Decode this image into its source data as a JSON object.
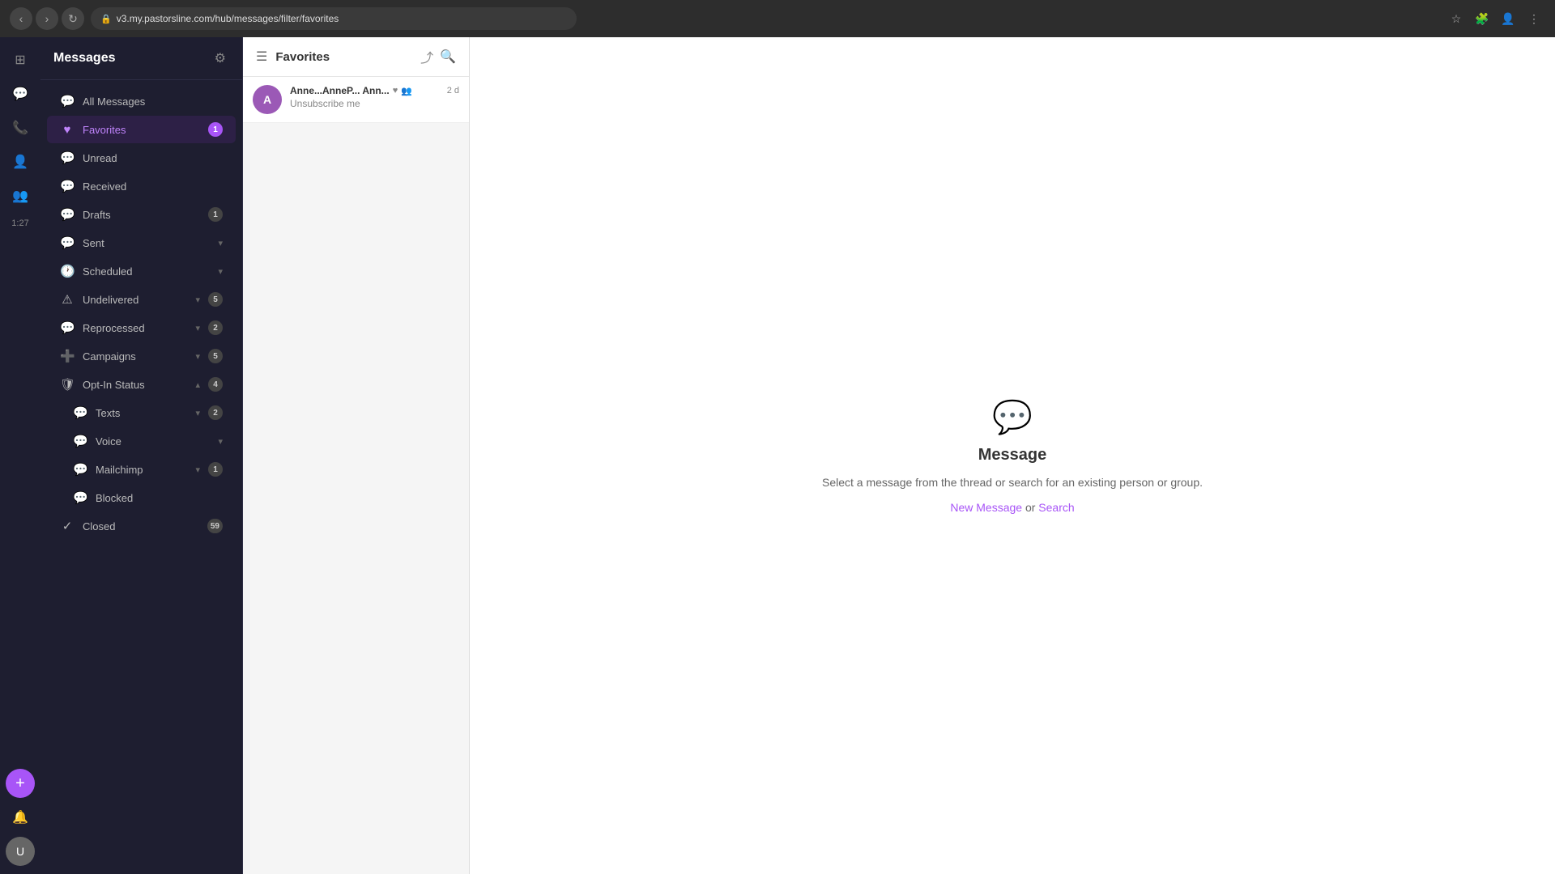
{
  "browser": {
    "url": "v3.my.pastorsline.com/hub/messages/filter/favorites",
    "lock_icon": "🔒"
  },
  "sidebar": {
    "title": "Messages",
    "nav_items": [
      {
        "id": "all-messages",
        "icon": "💬",
        "label": "All Messages",
        "badge": null,
        "active": false,
        "sub": false
      },
      {
        "id": "favorites",
        "icon": "♥",
        "label": "Favorites",
        "badge": "1",
        "active": true,
        "sub": false
      },
      {
        "id": "unread",
        "icon": "💬",
        "label": "Unread",
        "badge": null,
        "active": false,
        "sub": false
      },
      {
        "id": "received",
        "icon": "💬",
        "label": "Received",
        "badge": null,
        "active": false,
        "sub": false
      },
      {
        "id": "drafts",
        "icon": "💬",
        "label": "Drafts",
        "badge": "1",
        "active": false,
        "sub": false
      },
      {
        "id": "sent",
        "icon": "💬",
        "label": "Sent",
        "badge": null,
        "chevron": true,
        "active": false,
        "sub": false
      },
      {
        "id": "scheduled",
        "icon": "🕐",
        "label": "Scheduled",
        "badge": null,
        "chevron": true,
        "active": false,
        "sub": false
      },
      {
        "id": "undelivered",
        "icon": "⚠",
        "label": "Undelivered",
        "badge": "5",
        "chevron": true,
        "active": false,
        "sub": false
      },
      {
        "id": "reprocessed",
        "icon": "💬",
        "label": "Reprocessed",
        "badge": "2",
        "chevron": true,
        "active": false,
        "sub": false
      },
      {
        "id": "campaigns",
        "icon": "➕",
        "label": "Campaigns",
        "badge": "5",
        "chevron": true,
        "active": false,
        "sub": false
      },
      {
        "id": "opt-in-status",
        "icon": "🛡",
        "label": "Opt-In Status",
        "badge": "4",
        "chevron_up": true,
        "active": false,
        "sub": false
      },
      {
        "id": "texts",
        "icon": "💬",
        "label": "Texts",
        "badge": "2",
        "chevron": true,
        "active": false,
        "sub": true
      },
      {
        "id": "voice",
        "icon": "💬",
        "label": "Voice",
        "badge": null,
        "chevron": true,
        "active": false,
        "sub": true
      },
      {
        "id": "mailchimp",
        "icon": "💬",
        "label": "Mailchimp",
        "badge": "1",
        "chevron": true,
        "active": false,
        "sub": true
      },
      {
        "id": "blocked",
        "icon": "💬",
        "label": "Blocked",
        "badge": null,
        "active": false,
        "sub": true
      },
      {
        "id": "closed",
        "icon": "✓",
        "label": "Closed",
        "badge": "59",
        "active": false,
        "sub": false
      }
    ]
  },
  "favorites_panel": {
    "title": "Favorites",
    "conversation": {
      "name": "Anne...AnneP... Ann...",
      "avatar_initials": "A",
      "time": "2 d",
      "subtitle": "Unsubscribe me",
      "heart_icon": "♥",
      "people_icon": "👥"
    }
  },
  "main_content": {
    "title": "Message",
    "subtitle": "Select a message from the thread or search for an\nexisting person or group.",
    "new_message_label": "New Message",
    "or_text": "or",
    "search_label": "Search"
  },
  "icon_rail": {
    "time": "1:27",
    "icons": [
      {
        "id": "grid",
        "symbol": "⊞",
        "active": false
      },
      {
        "id": "messages",
        "symbol": "💬",
        "active": true
      },
      {
        "id": "phone",
        "symbol": "📞",
        "active": false
      },
      {
        "id": "person",
        "symbol": "👤",
        "active": false
      },
      {
        "id": "group",
        "symbol": "👥",
        "active": false
      }
    ],
    "notification_color": "#e74c3c",
    "add_button_label": "+",
    "bell_symbol": "🔔",
    "avatar_initials": "U"
  }
}
